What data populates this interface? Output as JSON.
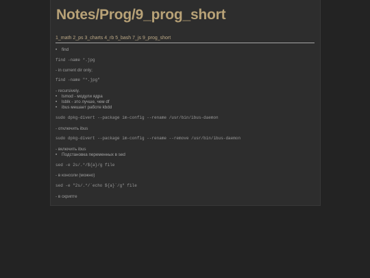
{
  "title": "Notes/Prog/9_prog_short",
  "nav": [
    "1_math",
    "2_ps",
    "3_charts",
    "4_rb",
    "5_bash",
    "7_js",
    "9_prog_short"
  ],
  "content": {
    "b_find": "find",
    "c_find1": "find -name *.jpg",
    "t_current": "- in current dir only;",
    "c_find2": "find -name \"*.jpg\"",
    "t_recursive": "- recursively.",
    "b_lsmod": "lsmod - модули ядра",
    "b_lsblk": "lsblk - это лучше, чем df",
    "b_ibus": "ibus мешает работе kbdd",
    "c_divert1": "sudo dpkg-divert --package im-config --rename /usr/bin/ibus-daemon",
    "t_off": "- отключить ibus",
    "c_divert2": "sudo dpkg-divert --package im-config --rename --remove /usr/bin/ibus-daemon",
    "t_on": "- включить ibus",
    "b_subst": "Подстановка переменных в sed",
    "c_sed1": "sed -e 2s/.*/${a}/g file",
    "t_console": "- в консоли (можно)",
    "c_sed2": "sed -e \"2s/.*/`echo ${a}`/g\" file",
    "t_script": "- в скрипте"
  }
}
